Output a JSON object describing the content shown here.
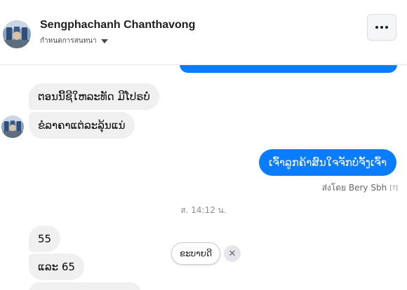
{
  "header": {
    "contact_name": "Sengphachanh Chanthavong",
    "subtitle": "กำหนดการสนทนา",
    "menu_icon": "more-horizontal-icon"
  },
  "messages": {
    "received_1": "ຕອນນີ້ຊີໃຫລະທັດ ມີໂປຣບໍ່",
    "received_2": "ຂໍລາຄາແຕ່ລະລຸ້ນແນ່",
    "sent_1": "ເຈົ້າລູກຄ້າສົນໃຈຈັກບໍ່ຈັ້ງເຈົ້າ",
    "sent_by": "ส่งโดย Bery Sbh",
    "sent_by_help": "[?]",
    "timestamp": "ส. 14:12 น.",
    "received_3": "55",
    "received_4": "ແລະ 65"
  },
  "suggestion": {
    "label": "ຂະບາຍດີ",
    "close_glyph": "✕"
  },
  "colors": {
    "accent": "#0a7cff",
    "bubble_received": "#f0f0f0"
  }
}
